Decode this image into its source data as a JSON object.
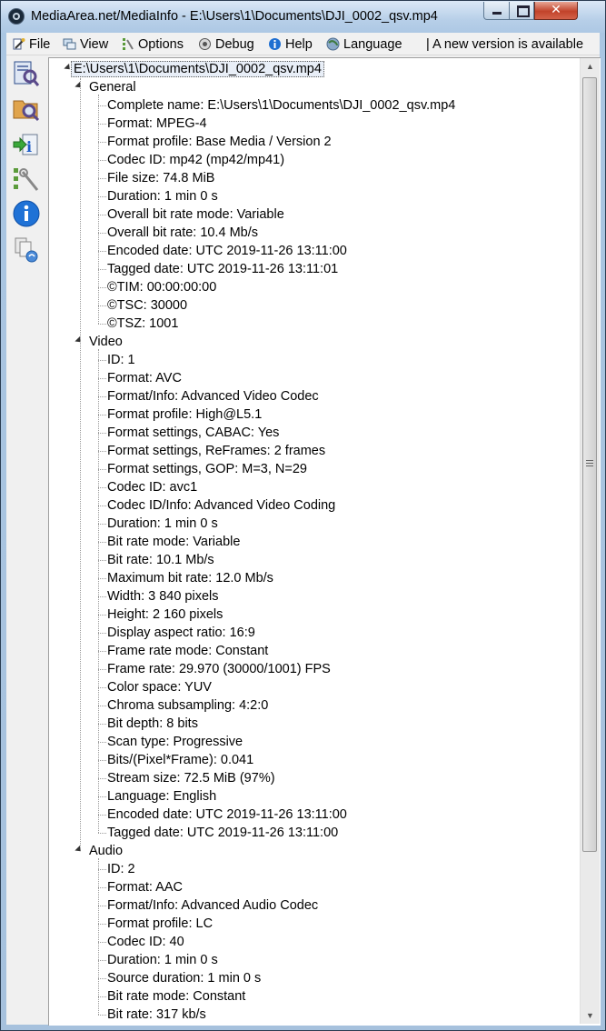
{
  "window": {
    "title": "MediaArea.net/MediaInfo - E:\\Users\\1\\Documents\\DJI_0002_qsv.mp4",
    "close_glyph": "✕"
  },
  "menu": {
    "items": [
      {
        "label": "File",
        "icon": "file-wand-icon"
      },
      {
        "label": "View",
        "icon": "view-icon"
      },
      {
        "label": "Options",
        "icon": "options-icon"
      },
      {
        "label": "Debug",
        "icon": "debug-icon"
      },
      {
        "label": "Help",
        "icon": "help-icon"
      },
      {
        "label": "Language",
        "icon": "globe-icon"
      }
    ],
    "notice": "| A new version is available"
  },
  "toolbar": {
    "tools": [
      "open-file-icon",
      "open-folder-icon",
      "export-info-icon",
      "preferences-icon",
      "about-icon",
      "knowledge-base-icon"
    ]
  },
  "tree": {
    "root": "E:\\Users\\1\\Documents\\DJI_0002_qsv.mp4",
    "sections": [
      {
        "name": "General",
        "entries": [
          "Complete name: E:\\Users\\1\\Documents\\DJI_0002_qsv.mp4",
          "Format: MPEG-4",
          "Format profile: Base Media / Version 2",
          "Codec ID: mp42 (mp42/mp41)",
          "File size: 74.8 MiB",
          "Duration: 1 min 0 s",
          "Overall bit rate mode: Variable",
          "Overall bit rate: 10.4 Mb/s",
          "Encoded date: UTC 2019-11-26 13:11:00",
          "Tagged date: UTC 2019-11-26 13:11:01",
          "©TIM: 00:00:00:00",
          "©TSC: 30000",
          "©TSZ: 1001"
        ]
      },
      {
        "name": "Video",
        "entries": [
          "ID: 1",
          "Format: AVC",
          "Format/Info: Advanced Video Codec",
          "Format profile: High@L5.1",
          "Format settings, CABAC: Yes",
          "Format settings, ReFrames: 2 frames",
          "Format settings, GOP: M=3, N=29",
          "Codec ID: avc1",
          "Codec ID/Info: Advanced Video Coding",
          "Duration: 1 min 0 s",
          "Bit rate mode: Variable",
          "Bit rate: 10.1 Mb/s",
          "Maximum bit rate: 12.0 Mb/s",
          "Width: 3 840 pixels",
          "Height: 2 160 pixels",
          "Display aspect ratio: 16:9",
          "Frame rate mode: Constant",
          "Frame rate: 29.970 (30000/1001) FPS",
          "Color space: YUV",
          "Chroma subsampling: 4:2:0",
          "Bit depth: 8 bits",
          "Scan type: Progressive",
          "Bits/(Pixel*Frame): 0.041",
          "Stream size: 72.5 MiB (97%)",
          "Language: English",
          "Encoded date: UTC 2019-11-26 13:11:00",
          "Tagged date: UTC 2019-11-26 13:11:00"
        ]
      },
      {
        "name": "Audio",
        "entries": [
          "ID: 2",
          "Format: AAC",
          "Format/Info: Advanced Audio Codec",
          "Format profile: LC",
          "Codec ID: 40",
          "Duration: 1 min 0 s",
          "Source duration: 1 min 0 s",
          "Bit rate mode: Constant",
          "Bit rate: 317 kb/s"
        ]
      }
    ]
  },
  "scrollbar": {
    "up": "▲",
    "down": "▼"
  }
}
